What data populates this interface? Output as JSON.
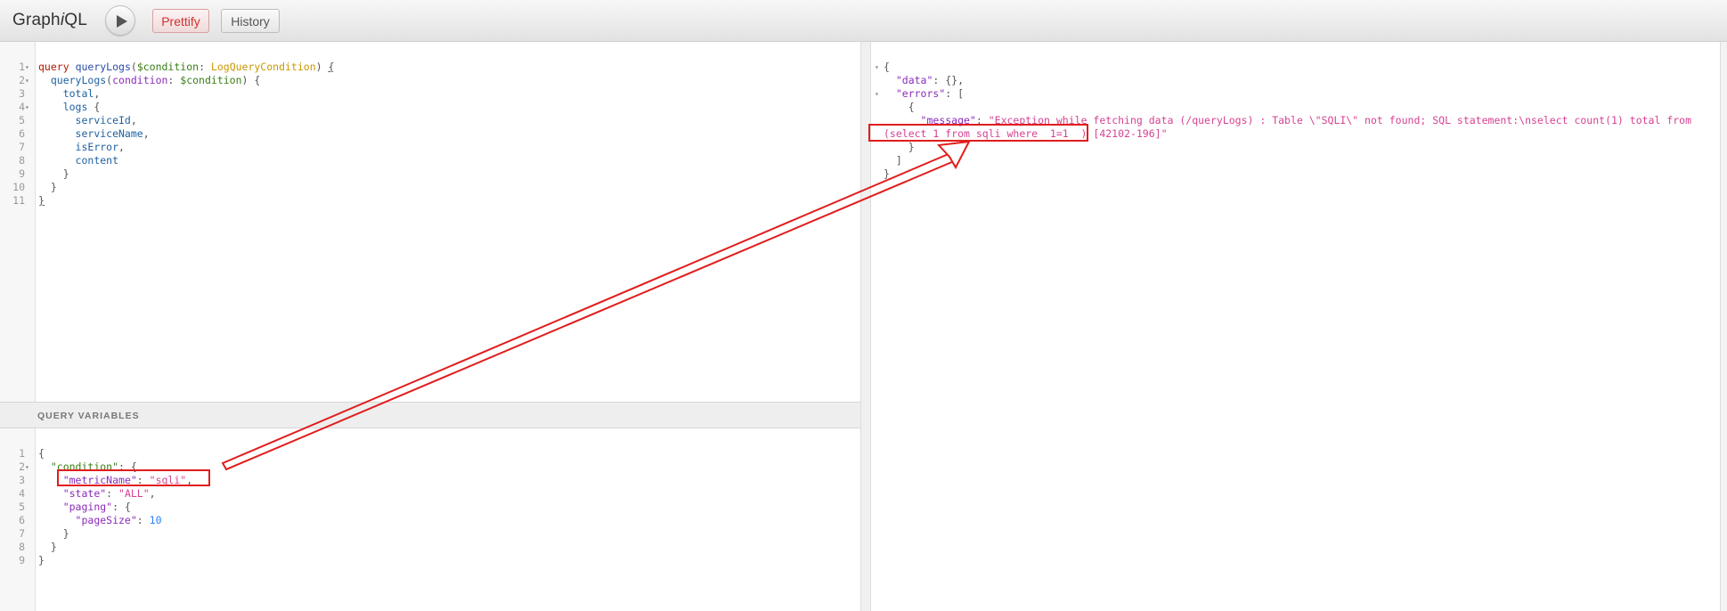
{
  "toolbar": {
    "title_pre": "Graph",
    "title_i": "i",
    "title_post": "QL",
    "prettify_label": "Prettify",
    "history_label": "History"
  },
  "query_editor": {
    "line_numbers": [
      "1",
      "2",
      "3",
      "4",
      "5",
      "6",
      "7",
      "8",
      "9",
      "10",
      "11"
    ],
    "tokens": {
      "l1_kw": "query",
      "l1_name": "queryLogs",
      "l1_var": "$condition",
      "l1_type": "LogQueryCondition",
      "l2_field": "queryLogs",
      "l2_arg": "condition",
      "l2_var": "$condition",
      "f_total": "total",
      "f_logs": "logs",
      "f_serviceId": "serviceId",
      "f_serviceName": "serviceName",
      "f_isError": "isError",
      "f_content": "content"
    }
  },
  "variables_panel": {
    "header": "QUERY VARIABLES",
    "line_numbers": [
      "1",
      "2",
      "3",
      "4",
      "5",
      "6",
      "7",
      "8",
      "9"
    ],
    "tokens": {
      "k_condition": "\"condition\"",
      "k_metricName": "\"metricName\"",
      "v_metricName": "\"sqli\"",
      "k_state": "\"state\"",
      "v_state": "\"ALL\"",
      "k_paging": "\"paging\"",
      "k_pageSize": "\"pageSize\"",
      "v_pageSize": "10"
    }
  },
  "result_panel": {
    "tokens": {
      "k_data": "\"data\"",
      "k_errors": "\"errors\"",
      "k_message": "\"message\"",
      "msg_line1": "\"Exception while fetching data (/queryLogs) : Table \\\"SQLI\\\" not found; SQL statement:\\nselect count(1) total from",
      "msg_line2a": "(select 1 from sqli where  1=1  )",
      "msg_line2b": " [42102-196]\""
    }
  },
  "colors": {
    "annotation_red": "#e11d1d",
    "keyword": "#b11a04",
    "string": "#d64292",
    "property": "#1f61a0"
  }
}
